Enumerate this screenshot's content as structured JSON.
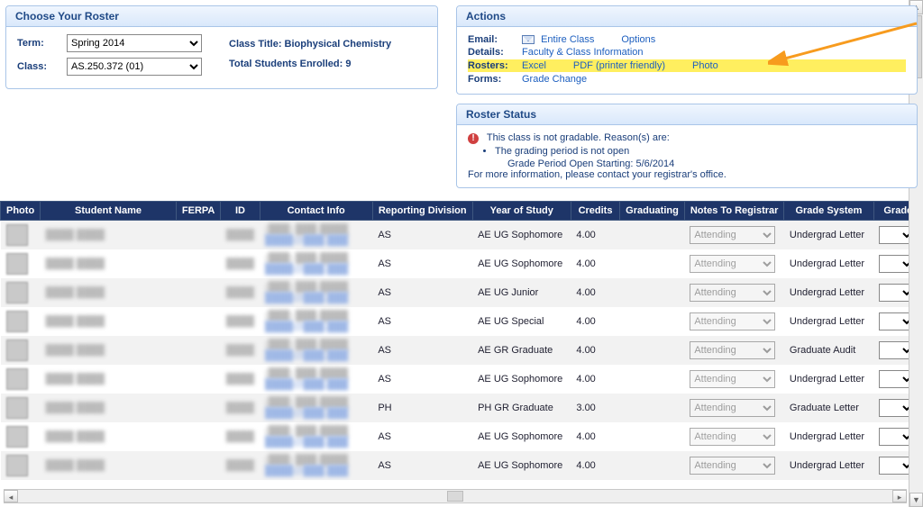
{
  "roster_panel": {
    "title": "Choose Your Roster",
    "term_label": "Term:",
    "term_value": "Spring 2014",
    "class_label": "Class:",
    "class_value": "AS.250.372 (01)",
    "class_title_label": "Class Title: Biophysical Chemistry",
    "enrolled_label": "Total Students Enrolled: 9"
  },
  "actions_panel": {
    "title": "Actions",
    "rows": {
      "email": {
        "label": "Email:",
        "links": [
          "Entire Class",
          "Options"
        ]
      },
      "details": {
        "label": "Details:",
        "links": [
          "Faculty & Class Information"
        ]
      },
      "rosters": {
        "label": "Rosters:",
        "links": [
          "Excel",
          "PDF (printer friendly)",
          "Photo"
        ]
      },
      "forms": {
        "label": "Forms:",
        "links": [
          "Grade Change"
        ]
      }
    }
  },
  "status_panel": {
    "title": "Roster Status",
    "line1": "This class is not gradable. Reason(s) are:",
    "bullet1": "The grading period is not open",
    "bullet2": "Grade Period Open Starting: 5/6/2014",
    "line2": "For more information, please contact your registrar's office."
  },
  "table": {
    "headers": {
      "photo": "Photo",
      "name": "Student Name",
      "ferpa": "FERPA",
      "id": "ID",
      "contact": "Contact Info",
      "rdiv": "Reporting Division",
      "year": "Year of Study",
      "credits": "Credits",
      "grad": "Graduating",
      "notes": "Notes To Registrar",
      "gsys": "Grade System",
      "grade": "Grade"
    },
    "note_option": "Attending",
    "rows": [
      {
        "rdiv": "AS",
        "year": "AE UG Sophomore",
        "credits": "4.00",
        "gsys": "Undergrad Letter"
      },
      {
        "rdiv": "AS",
        "year": "AE UG Sophomore",
        "credits": "4.00",
        "gsys": "Undergrad Letter"
      },
      {
        "rdiv": "AS",
        "year": "AE UG Junior",
        "credits": "4.00",
        "gsys": "Undergrad Letter"
      },
      {
        "rdiv": "AS",
        "year": "AE UG Special",
        "credits": "4.00",
        "gsys": "Undergrad Letter"
      },
      {
        "rdiv": "AS",
        "year": "AE GR Graduate",
        "credits": "4.00",
        "gsys": "Graduate Audit"
      },
      {
        "rdiv": "AS",
        "year": "AE UG Sophomore",
        "credits": "4.00",
        "gsys": "Undergrad Letter"
      },
      {
        "rdiv": "PH",
        "year": "PH GR Graduate",
        "credits": "3.00",
        "gsys": "Graduate Letter"
      },
      {
        "rdiv": "AS",
        "year": "AE UG Sophomore",
        "credits": "4.00",
        "gsys": "Undergrad Letter"
      },
      {
        "rdiv": "AS",
        "year": "AE UG Sophomore",
        "credits": "4.00",
        "gsys": "Undergrad Letter"
      }
    ]
  }
}
